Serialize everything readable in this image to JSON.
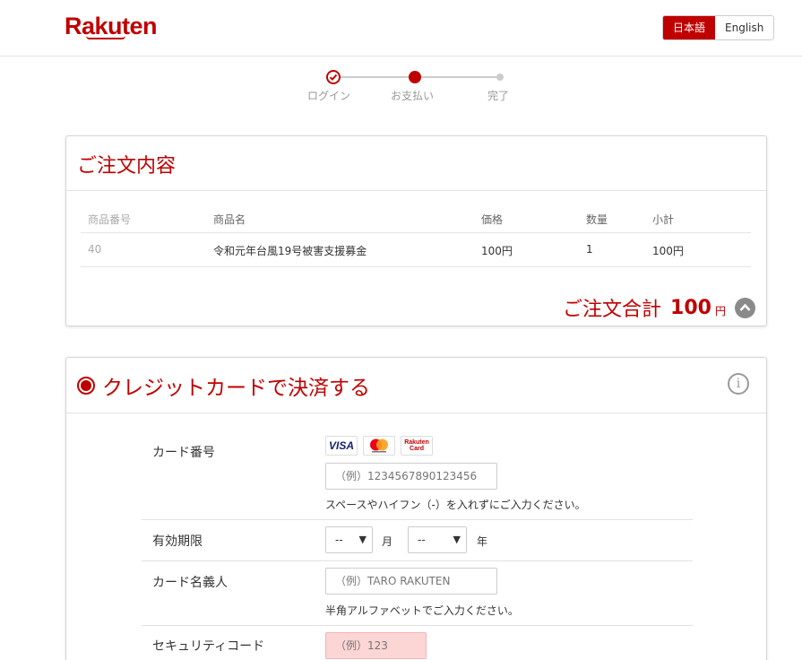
{
  "header": {
    "logo": "Rakuten",
    "lang_ja": "日本語",
    "lang_en": "English"
  },
  "steps": [
    {
      "label": "ログイン",
      "state": "done"
    },
    {
      "label": "お支払い",
      "state": "current"
    },
    {
      "label": "完了",
      "state": "pending"
    }
  ],
  "order": {
    "title": "ご注文内容",
    "columns": {
      "id": "商品番号",
      "name": "商品名",
      "price": "価格",
      "qty": "数量",
      "subtotal": "小計"
    },
    "rows": [
      {
        "id": "40",
        "name": "令和元年台風19号被害支援募金",
        "price": "100円",
        "qty": "1",
        "subtotal": "100円"
      }
    ],
    "total_label": "ご注文合計",
    "total_value": "100",
    "total_unit": "円"
  },
  "payment": {
    "title": "クレジットカードで決済する",
    "card_number_label": "カード番号",
    "card_brands": {
      "visa": "VISA",
      "rakuten": "Rakuten Card"
    },
    "card_number_placeholder": "（例）1234567890123456",
    "card_number_hint": "スペースやハイフン（-）を入れずにご入力ください。",
    "expiry_label": "有効期限",
    "expiry_month": "--",
    "expiry_month_unit": "月",
    "expiry_year": "--",
    "expiry_year_unit": "年",
    "holder_label": "カード名義人",
    "holder_placeholder": "（例）TARO RAKUTEN",
    "holder_hint": "半角アルファベットでご入力ください。",
    "security_label": "セキュリティコード",
    "security_placeholder": "（例）123"
  },
  "colors": {
    "brand": "#bf0000",
    "error_bg": "#fcd5d5"
  }
}
